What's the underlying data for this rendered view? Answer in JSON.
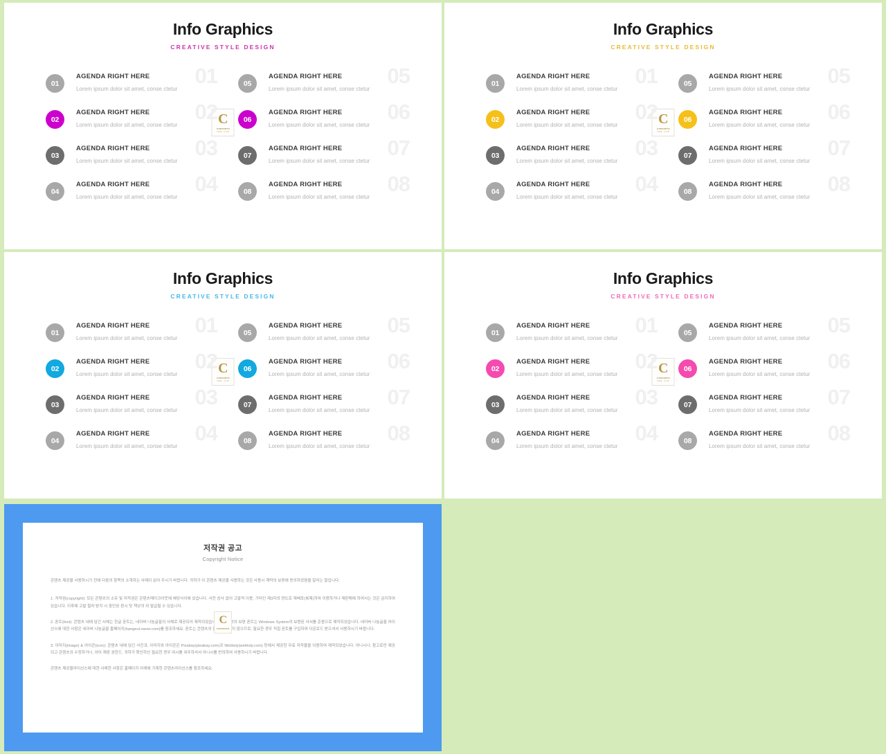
{
  "canvas": {
    "background_color": "#d5ebba"
  },
  "logo": {
    "letter": "C",
    "wordmark": "CONTENTS",
    "tagline": "FREE · CLUB"
  },
  "common": {
    "title": "Info Graphics",
    "subtitle": "CREATIVE STYLE DESIGN",
    "item_title": "AGENDA RIGHT HERE",
    "item_desc": "Lorem ipsum dolor sit amet, conse ctetur",
    "gray_light": "#a8a8a8",
    "gray_dark": "#6d6d6d",
    "ghost_color": "#f0f0f0"
  },
  "slides": [
    {
      "name": "magenta",
      "accent": "#cc00cc",
      "subtitle_color": "#cc33aa",
      "left": [
        {
          "num": "01",
          "color": "#a8a8a8"
        },
        {
          "num": "02",
          "color": "#cc00cc"
        },
        {
          "num": "03",
          "color": "#6d6d6d"
        },
        {
          "num": "04",
          "color": "#a8a8a8"
        }
      ],
      "right": [
        {
          "num": "05",
          "color": "#a8a8a8"
        },
        {
          "num": "06",
          "color": "#cc00cc"
        },
        {
          "num": "07",
          "color": "#6d6d6d"
        },
        {
          "num": "08",
          "color": "#a8a8a8"
        }
      ]
    },
    {
      "name": "yellow",
      "accent": "#f5c01a",
      "subtitle_color": "#e8bb33",
      "left": [
        {
          "num": "01",
          "color": "#a8a8a8"
        },
        {
          "num": "02",
          "color": "#f5c01a"
        },
        {
          "num": "03",
          "color": "#6d6d6d"
        },
        {
          "num": "04",
          "color": "#a8a8a8"
        }
      ],
      "right": [
        {
          "num": "05",
          "color": "#a8a8a8"
        },
        {
          "num": "06",
          "color": "#f5c01a"
        },
        {
          "num": "07",
          "color": "#6d6d6d"
        },
        {
          "num": "08",
          "color": "#a8a8a8"
        }
      ]
    },
    {
      "name": "cyan",
      "accent": "#12a8e0",
      "subtitle_color": "#45b8e8",
      "left": [
        {
          "num": "01",
          "color": "#a8a8a8"
        },
        {
          "num": "02",
          "color": "#12a8e0"
        },
        {
          "num": "03",
          "color": "#6d6d6d"
        },
        {
          "num": "04",
          "color": "#a8a8a8"
        }
      ],
      "right": [
        {
          "num": "05",
          "color": "#a8a8a8"
        },
        {
          "num": "06",
          "color": "#12a8e0"
        },
        {
          "num": "07",
          "color": "#6d6d6d"
        },
        {
          "num": "08",
          "color": "#a8a8a8"
        }
      ]
    },
    {
      "name": "pink",
      "accent": "#f54aae",
      "subtitle_color": "#f06bb5",
      "left": [
        {
          "num": "01",
          "color": "#a8a8a8"
        },
        {
          "num": "02",
          "color": "#f54aae"
        },
        {
          "num": "03",
          "color": "#6d6d6d"
        },
        {
          "num": "04",
          "color": "#a8a8a8"
        }
      ],
      "right": [
        {
          "num": "05",
          "color": "#a8a8a8"
        },
        {
          "num": "06",
          "color": "#f54aae"
        },
        {
          "num": "07",
          "color": "#6d6d6d"
        },
        {
          "num": "08",
          "color": "#a8a8a8"
        }
      ]
    }
  ],
  "notice": {
    "frame_color": "#4d9af0",
    "title_ko": "저작권 공고",
    "title_en": "Copyright Notice",
    "paragraphs": [
      "콘텐츠 제공물 사용하시기 전에 다음의 항목의 소개하는 사례이 읽어 주시기 바랍니다. 귀하가 이 콘텐츠 제공물 사용하는 것은 사용시 계약의 보증에 동의하셨음을 알리는 말입니다.",
      "1. 저작권(copyright): 모든 콘텐츠의 소유 및 저작권은 콘텐츠메이크아웃에 해당사이에 있습니다. 사전 승낙 없이 고발적 이용, 기타인 제3자의 양도로 재배포(복제)하여 이용하거나 재판매에 하여서는 것은 금지하여 있습니다. 이후에 고발 절차 받지 시 중단된 판시 팃 책상의 외 발급될 수 있습니다.",
      "2. 폰트(font): 콘텐츠 내에 담긴 서체는 한글 폰트는, 네이버 나눔글꼴의 서체로 제공되어 제작되었습니다. 한글 외의 보편 폰트는 Windows System의 보편된 사서를 준용으로 제작되었습니다. 네이버 나눔글꼴 라이선스에 대한 사항은 네이버 나눔글꼴 홈페이지(hangeul.naver.com)를 참조하세요. 폰트는 콘텐츠의 함께 제공되지 않으므로, 필요한 경우 직접 폰트를 구입하여 다운로드 받으셔서 사용하시기 바랍니다.",
      "3. 이미지(image) & 아이콘(icon): 콘텐츠 내에 담긴 사진과, 이미지와 아이콘은 Pixabay(pixabay.com)과 Webtoly(webtoly.com) 등에서 제공한 무료 저작물을 이용하여 제작되었습니다. 아니시나, 참고로만 제공되고 콘텐츠의 수정하거나, 아이 재판 권한드, 귀하가 확인하신 필요한 경우 여시를 위주하셔서 아니시를 반려하여 사용하시기 바랍니다.",
      "콘텐츠 제공물라이선스에 대한 사례한 사항은 홈페이지 아래에 기재한 콘텐츠라이선스를 참조하세요."
    ]
  }
}
